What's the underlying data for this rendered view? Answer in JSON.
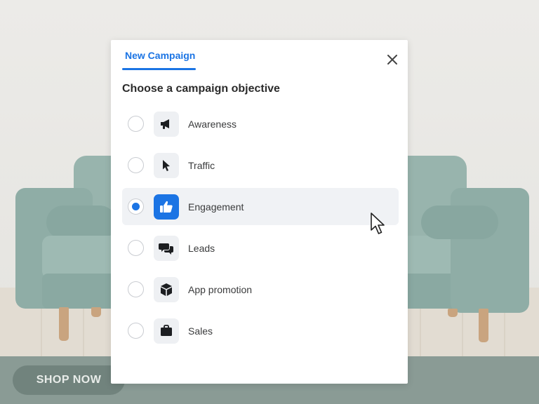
{
  "background": {
    "shop_button_label": "SHOP NOW"
  },
  "dialog": {
    "tab_label": "New Campaign",
    "close_icon": "close-icon",
    "heading": "Choose a campaign objective",
    "accent_color": "#1b74e4",
    "selected_objective": "Engagement",
    "objectives": [
      {
        "label": "Awareness",
        "icon": "megaphone-icon",
        "selected": false
      },
      {
        "label": "Traffic",
        "icon": "pointer-icon",
        "selected": false
      },
      {
        "label": "Engagement",
        "icon": "thumbs-up-icon",
        "selected": true
      },
      {
        "label": "Leads",
        "icon": "chat-bubbles-icon",
        "selected": false
      },
      {
        "label": "App promotion",
        "icon": "cube-icon",
        "selected": false
      },
      {
        "label": "Sales",
        "icon": "briefcase-icon",
        "selected": false
      }
    ]
  }
}
